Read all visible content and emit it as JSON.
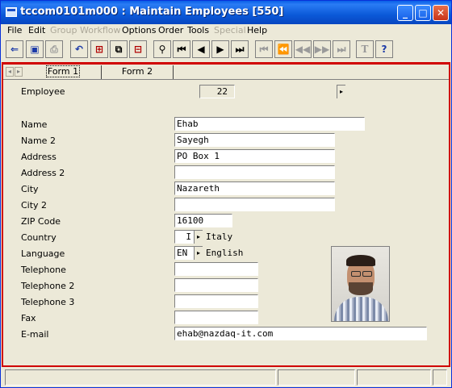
{
  "window": {
    "title": "tccom0101m000 : Maintain Employees [550]",
    "minimize": "_",
    "maximize": "□",
    "close": "✕"
  },
  "menu": [
    {
      "label": "File",
      "enabled": true
    },
    {
      "label": "Edit",
      "enabled": true
    },
    {
      "label": "Group",
      "enabled": false
    },
    {
      "label": "Workflow",
      "enabled": false
    },
    {
      "label": "Options",
      "enabled": true
    },
    {
      "label": "Order",
      "enabled": true
    },
    {
      "label": "Tools",
      "enabled": true
    },
    {
      "label": "Special",
      "enabled": false
    },
    {
      "label": "Help",
      "enabled": true
    }
  ],
  "toolbar": {
    "icons": [
      "exit-icon",
      "save-icon",
      "print-icon",
      "undo-icon",
      "insert-record-icon",
      "duplicate-record-icon",
      "delete-record-icon",
      "find-icon",
      "first-record-icon",
      "previous-record-icon",
      "next-record-icon",
      "last-record-icon",
      "first-set-icon",
      "previous-set-icon",
      "previous-page-icon",
      "next-page-icon",
      "last-set-icon",
      "text-icon",
      "context-help-icon"
    ],
    "text_glyph": "T",
    "help_glyph": "?"
  },
  "tabs": [
    "Form 1",
    "Form 2"
  ],
  "form": {
    "employee_label": "Employee",
    "employee_value": "22",
    "name_label": "Name",
    "name_value": "Ehab",
    "name2_label": "Name 2",
    "name2_value": "Sayegh",
    "address_label": "Address",
    "address_value": "PO Box 1",
    "address2_label": "Address 2",
    "address2_value": "",
    "city_label": "City",
    "city_value": "Nazareth",
    "city2_label": "City 2",
    "city2_value": "",
    "zip_label": "ZIP Code",
    "zip_value": "16100",
    "country_label": "Country",
    "country_code": "I",
    "country_desc": "Italy",
    "language_label": "Language",
    "language_code": "EN",
    "language_desc": "English",
    "telephone_label": "Telephone",
    "telephone_value": "",
    "telephone2_label": "Telephone 2",
    "telephone2_value": "",
    "telephone3_label": "Telephone 3",
    "telephone3_value": "",
    "fax_label": "Fax",
    "fax_value": "",
    "email_label": "E-mail",
    "email_value": "ehab@nazdaq-it.com"
  },
  "colors": {
    "title_bar": "#0a5fe8",
    "form_frame": "#d00000",
    "window_bg": "#ece9d8"
  }
}
